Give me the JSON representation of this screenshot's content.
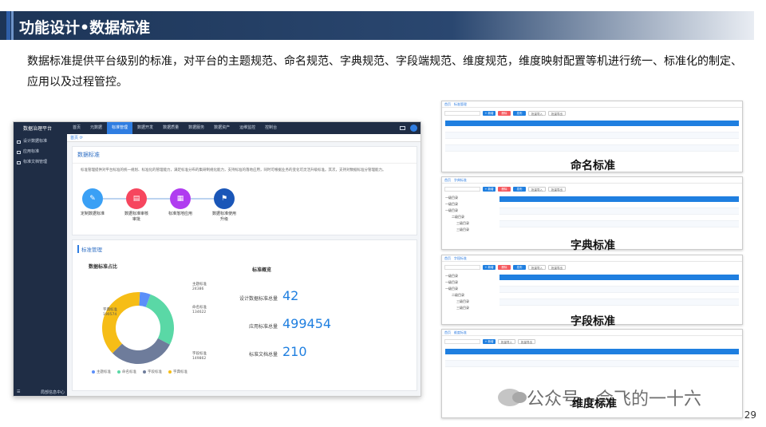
{
  "slide": {
    "title": "功能设计•数据标准",
    "description": "数据标准提供平台级别的标准，对平台的主题规范、命名规范、字典规范、字段端规范、维度规范，维度映射配置等机进行统一、标准化的制定、应用以及过程管控。",
    "page_number": "29",
    "watermark": "公众号 · 会飞的一十六"
  },
  "app": {
    "logo": "数据治理平台",
    "nav": [
      "首页",
      "元数据",
      "标准管理",
      "数据开发",
      "数据质量",
      "数据服务",
      "数据资产",
      "运维监控",
      "控制台"
    ],
    "active_nav": 2,
    "side": [
      "设计数据标准",
      "应用标准",
      "标准文档管理"
    ],
    "side_footer": "局部信息中心",
    "tab": "首页",
    "card1_title": "数据标准",
    "card1_desc": "标准管理提供对平台标准的统一规划、标准化的管理能力，满足标准分布的集研制规化能力，支持标准的落地应用，同时可根据业务的变化可灵活升级标准。其次，支持对数据标准分管理能力。",
    "steps": [
      {
        "label": "定制数据标准",
        "color": "#3aa0f5",
        "icon": "✎"
      },
      {
        "label": "数据标准审核审批",
        "color": "#f6465e",
        "icon": "▤"
      },
      {
        "label": "标准落地应用",
        "color": "#b03cf0",
        "icon": "▦"
      },
      {
        "label": "数据标准使用升级",
        "color": "#1a56b8",
        "icon": "⚑"
      }
    ],
    "card2_title": "标准管理",
    "pie_title": "数据标准占比",
    "overview_title": "标准概览",
    "pie_labels": [
      {
        "name": "主题标准",
        "value": "24386"
      },
      {
        "name": "命名标准",
        "value": "134622"
      },
      {
        "name": "字段标准",
        "value": "149862"
      },
      {
        "name": "字典标准",
        "value": "190574"
      }
    ],
    "legend": [
      {
        "name": "主题标准",
        "color": "#5b8ff9"
      },
      {
        "name": "命名标准",
        "color": "#5ad8a6"
      },
      {
        "name": "字段标准",
        "color": "#6e7c9b"
      },
      {
        "name": "字典标准",
        "color": "#f6bd16"
      }
    ],
    "stats": [
      {
        "label": "设计数据标准总量",
        "value": "42"
      },
      {
        "label": "应用标准总量",
        "value": "499454"
      },
      {
        "label": "标准文档总量",
        "value": "210"
      }
    ]
  },
  "shots": [
    {
      "label": "命名标准",
      "tab": "标准管理",
      "btn_a": "+ 新增",
      "btn_b": "删除",
      "btn_c": "发布",
      "imp": "批量导入",
      "exp": "批量导出"
    },
    {
      "label": "字典标准",
      "tab": "字典标准",
      "btn_a": "+ 新增",
      "btn_b": "删除",
      "btn_c": "发布",
      "imp": "批量导入",
      "exp": "批量导出",
      "tree": [
        "一级目录",
        "一级目录",
        "一级目录",
        "二级目录",
        "三级目录",
        "三级目录"
      ]
    },
    {
      "label": "字段标准",
      "tab": "字段标准",
      "btn_a": "+ 新增",
      "btn_b": "删除",
      "btn_c": "发布",
      "imp": "批量导入",
      "exp": "批量导出",
      "tree": [
        "一级目录",
        "一级目录",
        "一级目录",
        "二级目录",
        "三级目录",
        "三级目录"
      ]
    },
    {
      "label": "维度标准",
      "tab": "维度标准",
      "btn_a": "+ 新增",
      "imp": "批量导入",
      "exp": "批量导出"
    }
  ]
}
